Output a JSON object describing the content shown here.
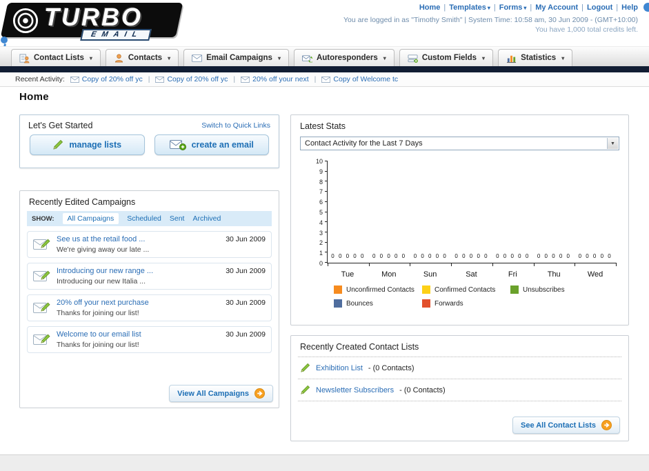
{
  "header": {
    "logo": {
      "line1": "TURBO",
      "line2": "EMAIL"
    },
    "nav_items": [
      {
        "label": "Home",
        "dropdown": false
      },
      {
        "label": "Templates",
        "dropdown": true
      },
      {
        "label": "Forms",
        "dropdown": true
      },
      {
        "label": "My Account",
        "dropdown": false
      },
      {
        "label": "Logout",
        "dropdown": false
      },
      {
        "label": "Help",
        "dropdown": false
      }
    ],
    "login_info": "You are logged in as \"Timothy Smith\" | System Time: 10:58 am, 30 Jun 2009 - (GMT+10:00)",
    "credits_info": "You have 1,000 total credits left."
  },
  "main_nav": {
    "items": [
      {
        "label": "Contact Lists"
      },
      {
        "label": "Contacts"
      },
      {
        "label": "Email Campaigns"
      },
      {
        "label": "Autoresponders"
      },
      {
        "label": "Custom Fields"
      },
      {
        "label": "Statistics"
      }
    ]
  },
  "recent_activity": {
    "label": "Recent Activity:",
    "items": [
      "Copy of 20% off yc",
      "Copy of 20% off yc",
      "20% off your next",
      "Copy of Welcome tc"
    ]
  },
  "page": {
    "title": "Home"
  },
  "get_started": {
    "title": "Let's Get Started",
    "switch_link": "Switch to Quick Links",
    "manage_lists_label": "manage lists",
    "create_email_label": "create an email"
  },
  "campaigns": {
    "title": "Recently Edited Campaigns",
    "show_label": "SHOW:",
    "filters": [
      "All Campaigns",
      "Scheduled",
      "Sent",
      "Archived"
    ],
    "active_filter": "All Campaigns",
    "items": [
      {
        "title": "See us at the retail food ...",
        "subtitle": "We're giving away our late ...",
        "date": "30 Jun 2009"
      },
      {
        "title": "Introducing our new range ...",
        "subtitle": "Introducing our new Italia ...",
        "date": "30 Jun 2009"
      },
      {
        "title": "20% off your next purchase",
        "subtitle": "Thanks for joining our list!",
        "date": "30 Jun 2009"
      },
      {
        "title": "Welcome to our email list",
        "subtitle": "Thanks for joining our list!",
        "date": "30 Jun 2009"
      }
    ],
    "view_all_label": "View All Campaigns"
  },
  "latest_stats": {
    "title": "Latest Stats",
    "dropdown_value": "Contact Activity for the Last 7 Days",
    "chart_data": {
      "type": "bar",
      "title": "Contact Activity for the Last 7 Days",
      "categories": [
        "Tue",
        "Mon",
        "Sun",
        "Sat",
        "Fri",
        "Thu",
        "Wed"
      ],
      "series": [
        {
          "name": "Unconfirmed Contacts",
          "color": "#f68b1f",
          "values": [
            0,
            0,
            0,
            0,
            0,
            0,
            0
          ]
        },
        {
          "name": "Confirmed Contacts",
          "color": "#fdd017",
          "values": [
            0,
            0,
            0,
            0,
            0,
            0,
            0
          ]
        },
        {
          "name": "Unsubscribes",
          "color": "#6aa12b",
          "values": [
            0,
            0,
            0,
            0,
            0,
            0,
            0
          ]
        },
        {
          "name": "Bounces",
          "color": "#4f6d9e",
          "values": [
            0,
            0,
            0,
            0,
            0,
            0,
            0
          ]
        },
        {
          "name": "Forwards",
          "color": "#e2502c",
          "values": [
            0,
            0,
            0,
            0,
            0,
            0,
            0
          ]
        }
      ],
      "ylim": [
        0,
        10
      ],
      "ytick_step": 1,
      "grid": false,
      "legend_position": "bottom"
    }
  },
  "contact_lists": {
    "title": "Recently Created Contact Lists",
    "items": [
      {
        "name": "Exhibition List",
        "detail": "- (0 Contacts)"
      },
      {
        "name": "Newsletter Subscribers",
        "detail": "- (0 Contacts)"
      }
    ],
    "see_all_label": "See All Contact Lists"
  }
}
